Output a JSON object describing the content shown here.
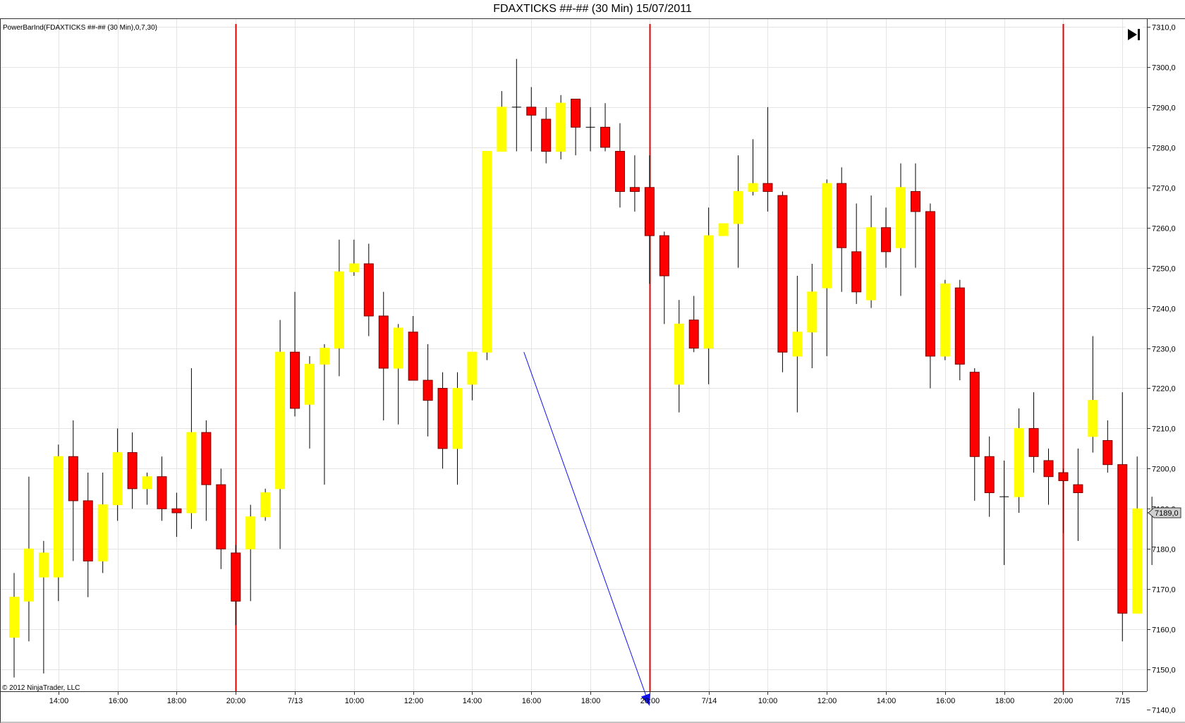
{
  "window": {
    "title": "FDAXTICKS ##-## (30 Min)  15/07/2011",
    "indicator_label": "PowerBarInd(FDAXTICKS ##-## (30 Min),0,7,30)",
    "copyright": "© 2012 NinjaTrader, LLC",
    "scroll_end_icon": "skip-to-end-icon"
  },
  "colors": {
    "up": "#ffff00",
    "down": "#ff0000",
    "outline": "#7a0000",
    "wick": "#000000",
    "session_line": "#e00000",
    "grid": "#e4e4e4",
    "arrow": "#1010ee"
  },
  "chart_data": {
    "type": "candlestick",
    "title": "FDAXTICKS ##-## (30 Min)  15/07/2011",
    "ylim": [
      7140,
      7310
    ],
    "y_ticks": [
      "7310,0",
      "7300,0",
      "7290,0",
      "7280,0",
      "7270,0",
      "7260,0",
      "7250,0",
      "7240,0",
      "7230,0",
      "7220,0",
      "7210,0",
      "7200,0",
      "7190,0",
      "7180,0",
      "7170,0",
      "7160,0",
      "7150,0",
      "7140,0"
    ],
    "x_ticks": [
      {
        "label": "14:00",
        "bar": 3
      },
      {
        "label": "16:00",
        "bar": 7
      },
      {
        "label": "18:00",
        "bar": 11
      },
      {
        "label": "20:00",
        "bar": 15
      },
      {
        "label": "7/13",
        "bar": 19
      },
      {
        "label": "10:00",
        "bar": 23
      },
      {
        "label": "12:00",
        "bar": 27
      },
      {
        "label": "14:00",
        "bar": 31
      },
      {
        "label": "16:00",
        "bar": 35
      },
      {
        "label": "18:00",
        "bar": 39
      },
      {
        "label": "20:00",
        "bar": 43
      },
      {
        "label": "7/14",
        "bar": 47
      },
      {
        "label": "10:00",
        "bar": 51
      },
      {
        "label": "12:00",
        "bar": 55
      },
      {
        "label": "14:00",
        "bar": 59
      },
      {
        "label": "16:00",
        "bar": 63
      },
      {
        "label": "18:00",
        "bar": 67
      },
      {
        "label": "20:00",
        "bar": 71
      },
      {
        "label": "7/15",
        "bar": 75
      }
    ],
    "session_breaks": [
      15,
      43,
      71
    ],
    "last_price": "7189,0",
    "arrow": {
      "from": {
        "bar": 34.5,
        "price": 7229
      },
      "to": {
        "bar": 43,
        "price": 7141
      }
    },
    "bars": [
      {
        "o": 7158,
        "h": 7174,
        "l": 7148,
        "c": 7168
      },
      {
        "o": 7167,
        "h": 7198,
        "l": 7157,
        "c": 7180
      },
      {
        "o": 7173,
        "h": 7182,
        "l": 7149,
        "c": 7179
      },
      {
        "o": 7173,
        "h": 7206,
        "l": 7167,
        "c": 7203
      },
      {
        "o": 7203,
        "h": 7212,
        "l": 7177,
        "c": 7192
      },
      {
        "o": 7192,
        "h": 7199,
        "l": 7168,
        "c": 7177
      },
      {
        "o": 7177,
        "h": 7199,
        "l": 7174,
        "c": 7191
      },
      {
        "o": 7191,
        "h": 7210,
        "l": 7187,
        "c": 7204
      },
      {
        "o": 7204,
        "h": 7209,
        "l": 7190,
        "c": 7195
      },
      {
        "o": 7195,
        "h": 7199,
        "l": 7191,
        "c": 7198
      },
      {
        "o": 7198,
        "h": 7203,
        "l": 7187,
        "c": 7190
      },
      {
        "o": 7190,
        "h": 7194,
        "l": 7183,
        "c": 7189
      },
      {
        "o": 7189,
        "h": 7225,
        "l": 7185,
        "c": 7209
      },
      {
        "o": 7209,
        "h": 7212,
        "l": 7187,
        "c": 7196
      },
      {
        "o": 7196,
        "h": 7200,
        "l": 7175,
        "c": 7180
      },
      {
        "o": 7179,
        "h": 7181,
        "l": 7161,
        "c": 7167
      },
      {
        "o": 7180,
        "h": 7191,
        "l": 7167,
        "c": 7188
      },
      {
        "o": 7188,
        "h": 7195,
        "l": 7187,
        "c": 7194
      },
      {
        "o": 7195,
        "h": 7237,
        "l": 7180,
        "c": 7229
      },
      {
        "o": 7229,
        "h": 7244,
        "l": 7213,
        "c": 7215
      },
      {
        "o": 7216,
        "h": 7228,
        "l": 7205,
        "c": 7226
      },
      {
        "o": 7226,
        "h": 7231,
        "l": 7196,
        "c": 7230
      },
      {
        "o": 7230,
        "h": 7257,
        "l": 7223,
        "c": 7249
      },
      {
        "o": 7249,
        "h": 7257,
        "l": 7248,
        "c": 7251
      },
      {
        "o": 7251,
        "h": 7256,
        "l": 7233,
        "c": 7238
      },
      {
        "o": 7238,
        "h": 7244,
        "l": 7212,
        "c": 7225
      },
      {
        "o": 7225,
        "h": 7236,
        "l": 7211,
        "c": 7235
      },
      {
        "o": 7234,
        "h": 7238,
        "l": 7222,
        "c": 7222
      },
      {
        "o": 7222,
        "h": 7231,
        "l": 7208,
        "c": 7217
      },
      {
        "o": 7220,
        "h": 7224,
        "l": 7200,
        "c": 7205
      },
      {
        "o": 7205,
        "h": 7224,
        "l": 7196,
        "c": 7220
      },
      {
        "o": 7221,
        "h": 7225,
        "l": 7217,
        "c": 7229
      },
      {
        "o": 7229,
        "h": 7248,
        "l": 7227,
        "c": 7279
      },
      {
        "o": 7279,
        "h": 7294,
        "l": 7279,
        "c": 7290
      },
      {
        "o": 7290,
        "h": 7302,
        "l": 7279,
        "c": 7290
      },
      {
        "o": 7290,
        "h": 7295,
        "l": 7279,
        "c": 7288
      },
      {
        "o": 7287,
        "h": 7290,
        "l": 7276,
        "c": 7279
      },
      {
        "o": 7279,
        "h": 7293,
        "l": 7277,
        "c": 7291
      },
      {
        "o": 7292,
        "h": 7292,
        "l": 7278,
        "c": 7285
      },
      {
        "o": 7285,
        "h": 7290,
        "l": 7279,
        "c": 7285
      },
      {
        "o": 7285,
        "h": 7291,
        "l": 7279,
        "c": 7280
      },
      {
        "o": 7279,
        "h": 7286,
        "l": 7265,
        "c": 7269
      },
      {
        "o": 7270,
        "h": 7278,
        "l": 7264,
        "c": 7269
      },
      {
        "o": 7270,
        "h": 7278,
        "l": 7246,
        "c": 7258
      },
      {
        "o": 7258,
        "h": 7259,
        "l": 7236,
        "c": 7248
      },
      {
        "o": 7221,
        "h": 7242,
        "l": 7214,
        "c": 7236
      },
      {
        "o": 7237,
        "h": 7243,
        "l": 7229,
        "c": 7230
      },
      {
        "o": 7230,
        "h": 7265,
        "l": 7221,
        "c": 7258
      },
      {
        "o": 7258,
        "h": 7260,
        "l": 7258,
        "c": 7261
      },
      {
        "o": 7261,
        "h": 7278,
        "l": 7250,
        "c": 7269
      },
      {
        "o": 7269,
        "h": 7282,
        "l": 7268,
        "c": 7271
      },
      {
        "o": 7271,
        "h": 7290,
        "l": 7264,
        "c": 7269
      },
      {
        "o": 7268,
        "h": 7269,
        "l": 7224,
        "c": 7229
      },
      {
        "o": 7228,
        "h": 7248,
        "l": 7214,
        "c": 7234
      },
      {
        "o": 7234,
        "h": 7251,
        "l": 7225,
        "c": 7244
      },
      {
        "o": 7245,
        "h": 7272,
        "l": 7228,
        "c": 7271
      },
      {
        "o": 7271,
        "h": 7275,
        "l": 7244,
        "c": 7255
      },
      {
        "o": 7254,
        "h": 7266,
        "l": 7241,
        "c": 7244
      },
      {
        "o": 7242,
        "h": 7268,
        "l": 7240,
        "c": 7260
      },
      {
        "o": 7260,
        "h": 7265,
        "l": 7250,
        "c": 7254
      },
      {
        "o": 7255,
        "h": 7276,
        "l": 7243,
        "c": 7270
      },
      {
        "o": 7269,
        "h": 7276,
        "l": 7250,
        "c": 7264
      },
      {
        "o": 7264,
        "h": 7266,
        "l": 7220,
        "c": 7228
      },
      {
        "o": 7228,
        "h": 7247,
        "l": 7227,
        "c": 7246
      },
      {
        "o": 7245,
        "h": 7247,
        "l": 7222,
        "c": 7226
      },
      {
        "o": 7224,
        "h": 7225,
        "l": 7192,
        "c": 7203
      },
      {
        "o": 7203,
        "h": 7208,
        "l": 7188,
        "c": 7194
      },
      {
        "o": 7193,
        "h": 7202,
        "l": 7176,
        "c": 7193
      },
      {
        "o": 7193,
        "h": 7215,
        "l": 7189,
        "c": 7210
      },
      {
        "o": 7210,
        "h": 7219,
        "l": 7199,
        "c": 7203
      },
      {
        "o": 7202,
        "h": 7205,
        "l": 7191,
        "c": 7198
      },
      {
        "o": 7199,
        "h": 7200,
        "l": 7184,
        "c": 7197
      },
      {
        "o": 7196,
        "h": 7205,
        "l": 7182,
        "c": 7194
      },
      {
        "o": 7208,
        "h": 7233,
        "l": 7204,
        "c": 7217
      },
      {
        "o": 7207,
        "h": 7212,
        "l": 7199,
        "c": 7201
      },
      {
        "o": 7201,
        "h": 7219,
        "l": 7157,
        "c": 7164
      },
      {
        "o": 7164,
        "h": 7203,
        "l": 7164,
        "c": 7190
      },
      {
        "o": 7189,
        "h": 7193,
        "l": 7176,
        "c": 7189
      }
    ]
  }
}
